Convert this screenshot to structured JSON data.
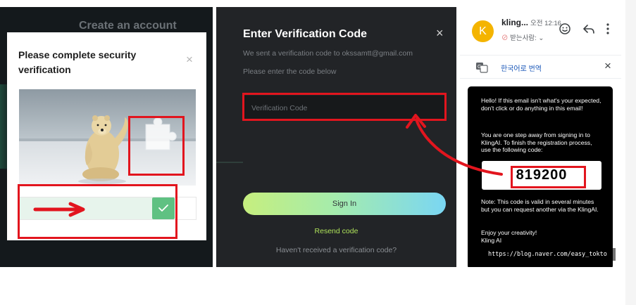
{
  "panel_captcha": {
    "background_title": "Create an account",
    "dialog_title": "Please complete security verification",
    "close_glyph": "×",
    "slider_handle_icon": "check-icon"
  },
  "panel_verify": {
    "title": "Enter Verification Code",
    "close_glyph": "×",
    "sent_message": "We sent a verification code to okssamtt@gmail.com",
    "instruction": "Please enter the code below",
    "code_input_placeholder": "Verification Code",
    "sign_in_label": "Sign In",
    "resend_label": "Resend code",
    "not_received_label": "Haven't received a verification code?"
  },
  "panel_email": {
    "avatar_letter": "K",
    "sender": "kling...",
    "time": "오전 12:16",
    "recipient": "받는사람: ⌄",
    "translate_label": "한국어로 번역",
    "close_glyph": "×",
    "body_paragraph_1": "Hello! If this email isn't what's your expected, don't click or do anything in this email!",
    "body_paragraph_2": "You are one step away from signing in to KlingAI. To finish the registration process, use the following code:",
    "code": "819200",
    "body_paragraph_3": "Note: This code is valid in several minutes but you can request another via the KlingAI.",
    "body_paragraph_4": "Enjoy your creativity!",
    "signature": "Kling AI",
    "watermark": "https://blog.naver.com/easy_tokto"
  },
  "colors": {
    "highlight_red": "#e2151e",
    "slider_green": "#5fc182",
    "resend_green": "#aee25a",
    "avatar_yellow": "#f4b400"
  }
}
